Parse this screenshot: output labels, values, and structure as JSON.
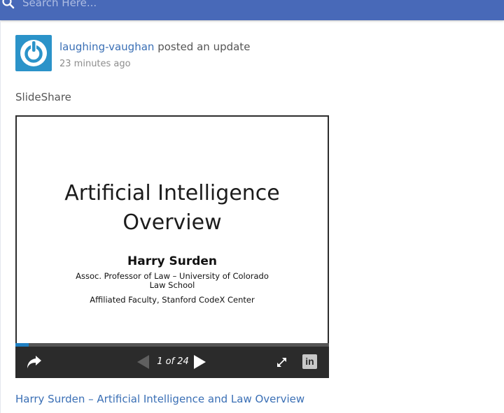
{
  "search": {
    "placeholder": "Search Here..."
  },
  "post": {
    "author": "laughing-vaughan",
    "action": "posted an update",
    "time": "23 minutes ago",
    "text": "SlideShare"
  },
  "embed": {
    "slide": {
      "title": "Artificial Intelligence\nOverview",
      "author": "Harry Surden",
      "role": "Assoc. Professor of Law – University of Colorado Law School",
      "affiliation": "Affiliated Faculty, Stanford CodeX Center"
    },
    "counter": "1 of 24",
    "progress": 0.0417,
    "linkedin_label": "in",
    "icons": [
      "share-icon",
      "prev-icon",
      "next-icon",
      "fullscreen-icon",
      "linkedin-icon"
    ]
  },
  "link_title": "Harry Surden – Artificial Intelligence and Law Overview",
  "colors": {
    "topbar": "#4869b8",
    "link": "#3a6fb5",
    "avatar": "#2b93c9",
    "progress": "#1f7fc2"
  }
}
